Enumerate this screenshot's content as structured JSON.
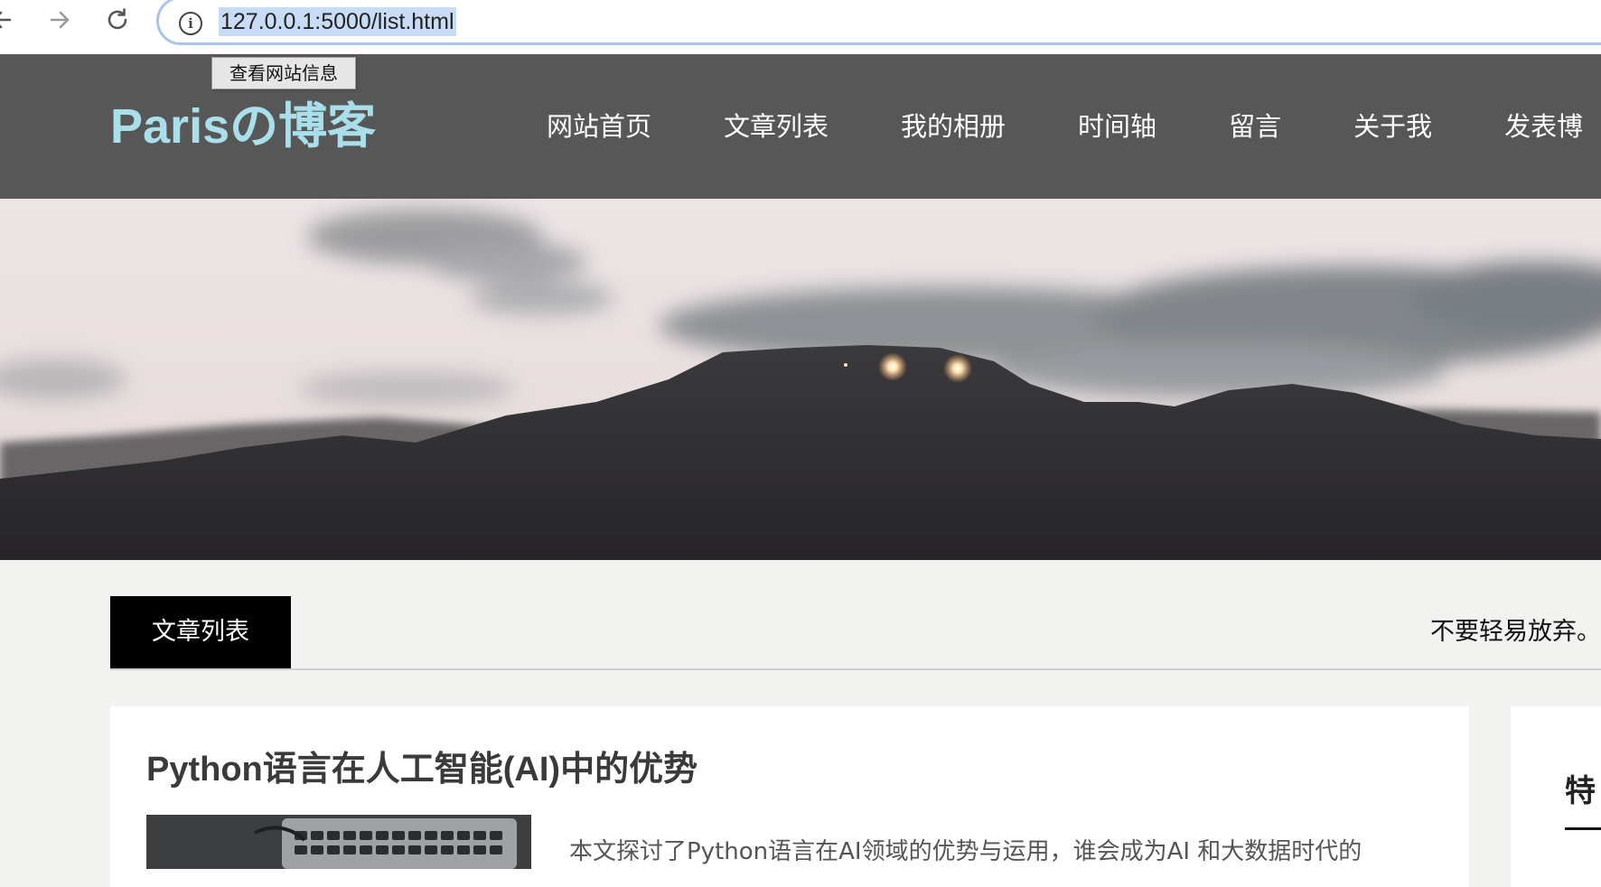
{
  "browser": {
    "url": "127.0.0.1:5000/list.html",
    "tooltip": "查看网站信息"
  },
  "header": {
    "logo": "Parisの博客",
    "nav": [
      {
        "label": "网站首页"
      },
      {
        "label": "文章列表"
      },
      {
        "label": "我的相册"
      },
      {
        "label": "时间轴"
      },
      {
        "label": "留言"
      },
      {
        "label": "关于我"
      },
      {
        "label": "发表博"
      }
    ]
  },
  "section": {
    "tab_label": "文章列表",
    "motto": "不要轻易放弃。"
  },
  "articles": [
    {
      "title": "Python语言在人工智能(AI)中的优势",
      "excerpt": "本文探讨了Python语言在AI领域的优势与运用，谁会成为AI 和大数据时代的"
    }
  ],
  "sidebar": {
    "title": "特"
  },
  "colors": {
    "header_bg": "#575757",
    "logo": "#a9dfea",
    "page_bg": "#f2f2f0",
    "address_focus": "#a9c4ea",
    "url_highlight": "#c9dcf6"
  }
}
